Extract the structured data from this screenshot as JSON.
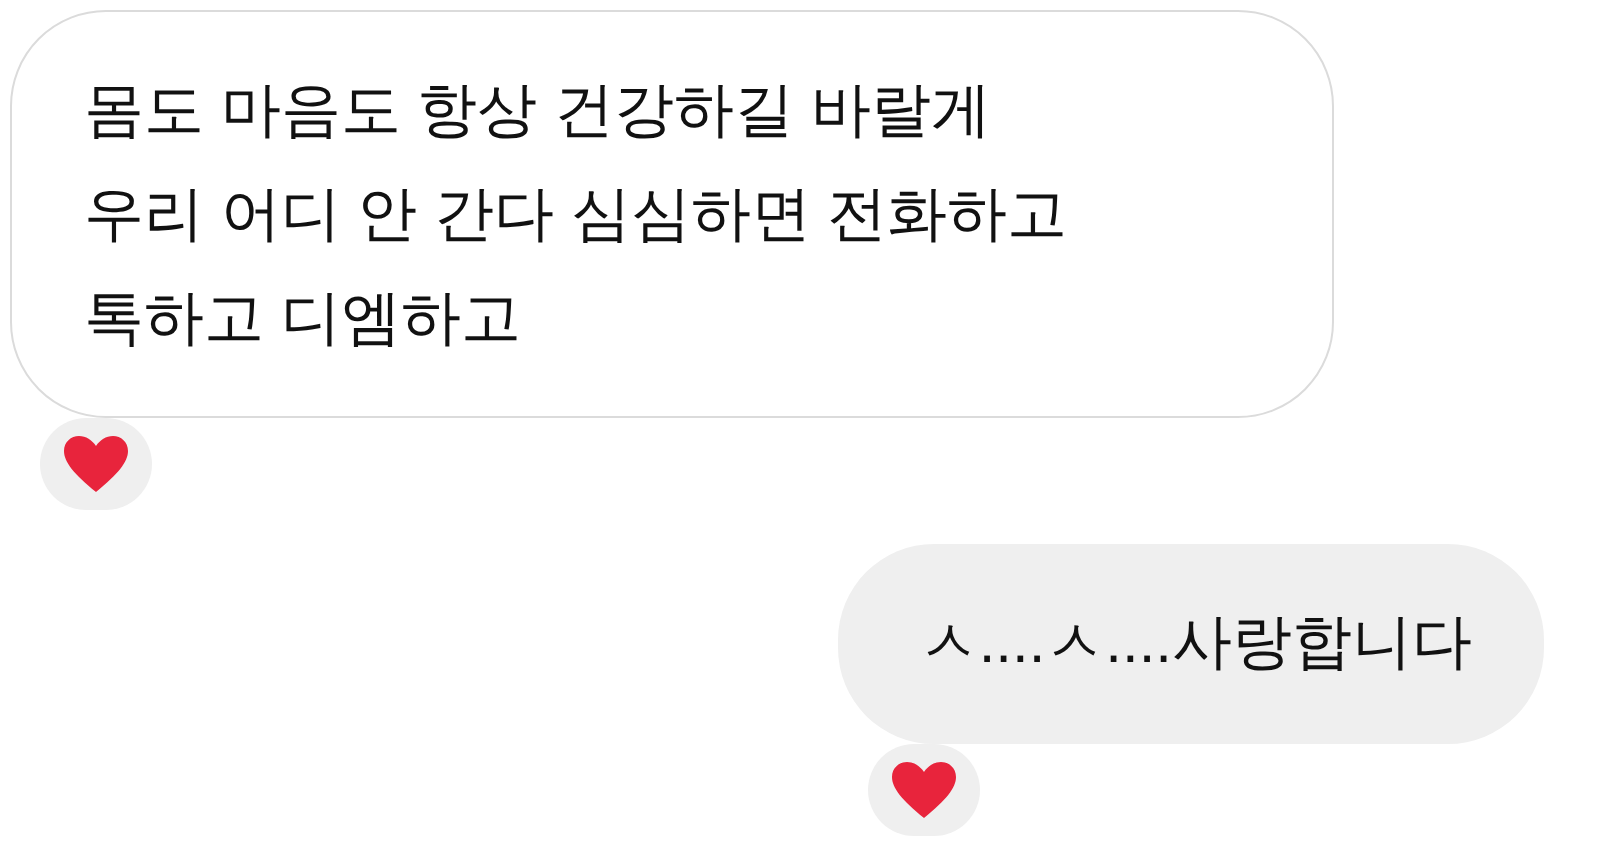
{
  "messages": [
    {
      "kind": "incoming",
      "lines": [
        "몸도 마음도 항상 건강하길 바랄게",
        "우리 어디 안 간다 심심하면 전화하고",
        "톡하고 디엠하고"
      ],
      "reacted": true
    },
    {
      "kind": "outgoing",
      "lines": [
        "ㅅ....ㅅ....사랑합니다"
      ],
      "reacted": true
    }
  ]
}
